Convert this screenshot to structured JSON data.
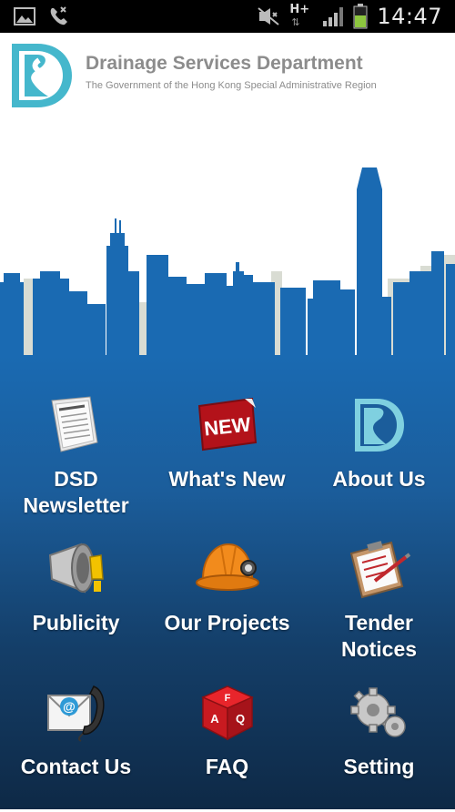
{
  "status_bar": {
    "time": "14:47",
    "left_icons": [
      "gallery-icon",
      "missed-call-icon"
    ],
    "right_icons": [
      "mute-icon",
      "hplus-data-icon",
      "signal-icon",
      "battery-icon"
    ],
    "network_label": "H+"
  },
  "header": {
    "title": "Drainage Services Department",
    "subtitle": "The Government of the Hong Kong Special Administrative Region",
    "logo_letters": "DSD"
  },
  "menu": {
    "items": [
      {
        "label_line1": "DSD",
        "label_line2": "Newsletter",
        "icon": "newspaper-icon"
      },
      {
        "label_line1": "What's New",
        "label_line2": "",
        "icon": "new-badge-icon",
        "badge_text": "NEW"
      },
      {
        "label_line1": "About Us",
        "label_line2": "",
        "icon": "dsd-logo-icon"
      },
      {
        "label_line1": "Publicity",
        "label_line2": "",
        "icon": "megaphone-icon"
      },
      {
        "label_line1": "Our Projects",
        "label_line2": "",
        "icon": "hard-hat-icon"
      },
      {
        "label_line1": "Tender",
        "label_line2": "Notices",
        "icon": "clipboard-icon"
      },
      {
        "label_line1": "Contact Us",
        "label_line2": "",
        "icon": "email-phone-icon"
      },
      {
        "label_line1": "FAQ",
        "label_line2": "",
        "icon": "faq-dice-icon",
        "dice_letters": [
          "F",
          "A",
          "Q"
        ]
      },
      {
        "label_line1": "Setting",
        "label_line2": "",
        "icon": "gears-icon"
      }
    ]
  },
  "colors": {
    "brand_teal": "#45b7cc",
    "skyline_blue": "#1a6ab2",
    "menu_bottom": "#0e2946",
    "title_gray": "#8c8c8c"
  }
}
